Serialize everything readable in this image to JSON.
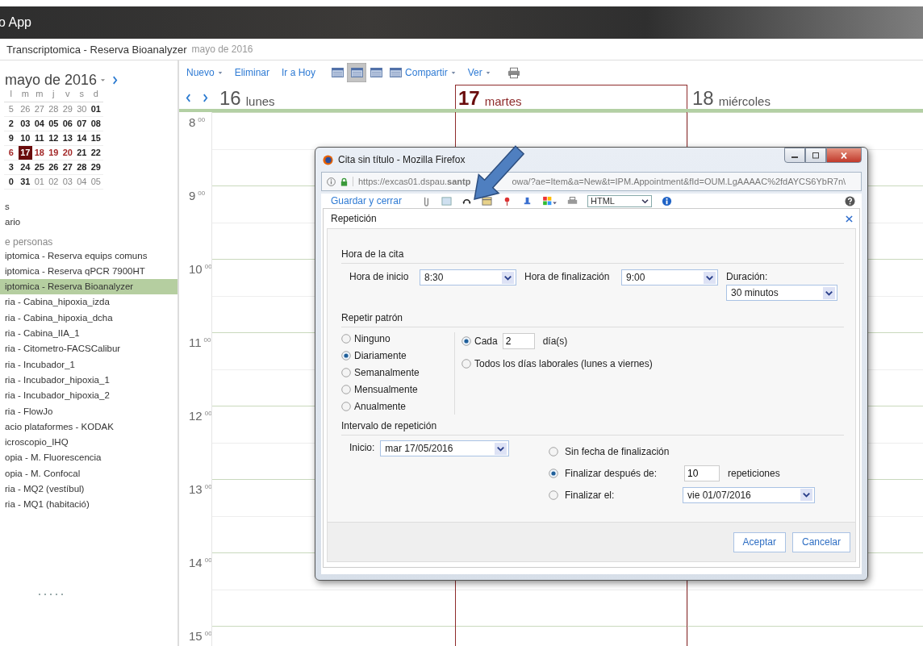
{
  "app_header": {
    "title": "o App"
  },
  "breadcrumb": {
    "calendar": "Transcriptomica - Reserva Bioanalyzer",
    "period": "mayo de 2016"
  },
  "mini_calendar": {
    "month": "mayo de 2016",
    "weekdays": [
      "l",
      "m",
      "m",
      "j",
      "v",
      "s",
      "d"
    ],
    "weeks": [
      [
        {
          "text": "5",
          "kind": "other",
          "selected": false
        },
        {
          "text": "26",
          "kind": "other",
          "selected": false
        },
        {
          "text": "27",
          "kind": "other",
          "selected": false
        },
        {
          "text": "28",
          "kind": "other",
          "selected": false
        },
        {
          "text": "29",
          "kind": "other",
          "selected": false
        },
        {
          "text": "30",
          "kind": "other",
          "selected": false
        },
        {
          "text": "01",
          "kind": "month",
          "selected": false
        }
      ],
      [
        {
          "text": "2",
          "kind": "month",
          "selected": false
        },
        {
          "text": "03",
          "kind": "month",
          "selected": false
        },
        {
          "text": "04",
          "kind": "month",
          "selected": false
        },
        {
          "text": "05",
          "kind": "month",
          "selected": false
        },
        {
          "text": "06",
          "kind": "month",
          "selected": false
        },
        {
          "text": "07",
          "kind": "month",
          "selected": false
        },
        {
          "text": "08",
          "kind": "month",
          "selected": false
        }
      ],
      [
        {
          "text": "9",
          "kind": "month",
          "selected": false
        },
        {
          "text": "10",
          "kind": "month",
          "selected": false
        },
        {
          "text": "11",
          "kind": "month",
          "selected": false
        },
        {
          "text": "12",
          "kind": "month",
          "selected": false
        },
        {
          "text": "13",
          "kind": "month",
          "selected": false
        },
        {
          "text": "14",
          "kind": "month",
          "selected": false
        },
        {
          "text": "15",
          "kind": "month",
          "selected": false
        }
      ],
      [
        {
          "text": "6",
          "kind": "week",
          "selected": false
        },
        {
          "text": "17",
          "kind": "week",
          "selected": true
        },
        {
          "text": "18",
          "kind": "week",
          "selected": false
        },
        {
          "text": "19",
          "kind": "week",
          "selected": false
        },
        {
          "text": "20",
          "kind": "week",
          "selected": false
        },
        {
          "text": "21",
          "kind": "month",
          "selected": false
        },
        {
          "text": "22",
          "kind": "month",
          "selected": false
        }
      ],
      [
        {
          "text": "3",
          "kind": "month",
          "selected": false
        },
        {
          "text": "24",
          "kind": "month",
          "selected": false
        },
        {
          "text": "25",
          "kind": "month",
          "selected": false
        },
        {
          "text": "26",
          "kind": "month",
          "selected": false
        },
        {
          "text": "27",
          "kind": "month",
          "selected": false
        },
        {
          "text": "28",
          "kind": "month",
          "selected": false
        },
        {
          "text": "29",
          "kind": "month",
          "selected": false
        }
      ],
      [
        {
          "text": "0",
          "kind": "month",
          "selected": false
        },
        {
          "text": "31",
          "kind": "month",
          "selected": false
        },
        {
          "text": "01",
          "kind": "other",
          "selected": false
        },
        {
          "text": "02",
          "kind": "other",
          "selected": false
        },
        {
          "text": "03",
          "kind": "other",
          "selected": false
        },
        {
          "text": "04",
          "kind": "other",
          "selected": false
        },
        {
          "text": "05",
          "kind": "other",
          "selected": false
        }
      ]
    ]
  },
  "sidebar": {
    "my_calendars": [
      "s",
      "ario"
    ],
    "people_heading": "e personas",
    "people": [
      {
        "label": "iptomica - Reserva equips comuns",
        "selected": false
      },
      {
        "label": "iptomica - Reserva qPCR 7900HT",
        "selected": false
      },
      {
        "label": "iptomica - Reserva Bioanalyzer",
        "selected": true
      },
      {
        "label": "ria - Cabina_hipoxia_izda",
        "selected": false
      },
      {
        "label": "ria - Cabina_hipoxia_dcha",
        "selected": false
      },
      {
        "label": "ria - Cabina_IIA_1",
        "selected": false
      },
      {
        "label": "ria - Citometro-FACSCalibur",
        "selected": false
      },
      {
        "label": "ria - Incubador_1",
        "selected": false
      },
      {
        "label": "ria - Incubador_hipoxia_1",
        "selected": false
      },
      {
        "label": "ria - Incubador_hipoxia_2",
        "selected": false
      },
      {
        "label": "ria - FlowJo",
        "selected": false
      },
      {
        "label": "acio plataformes - KODAK",
        "selected": false
      },
      {
        "label": "icroscopio_IHQ",
        "selected": false
      },
      {
        "label": "opia - M. Fluorescencia",
        "selected": false
      },
      {
        "label": "opia - M. Confocal",
        "selected": false
      },
      {
        "label": "ria - MQ2 (vestíbul)",
        "selected": false
      },
      {
        "label": "ria - MQ1 (habitació)",
        "selected": false
      }
    ]
  },
  "toolbar": [
    {
      "kind": "menu",
      "label": "Nuevo"
    },
    {
      "kind": "link",
      "label": "Eliminar"
    },
    {
      "kind": "link",
      "label": "Ir a Hoy"
    },
    {
      "kind": "view",
      "selected": false
    },
    {
      "kind": "view",
      "selected": true
    },
    {
      "kind": "view",
      "selected": false
    },
    {
      "kind": "view",
      "selected": false
    },
    {
      "kind": "menu",
      "label": "Compartir"
    },
    {
      "kind": "menu",
      "label": "Ver"
    },
    {
      "kind": "print"
    }
  ],
  "days": [
    {
      "number": "16",
      "name": "lunes",
      "today": false
    },
    {
      "number": "17",
      "name": "martes",
      "today": true
    },
    {
      "number": "18",
      "name": "miércoles",
      "today": false
    }
  ],
  "hours": [
    {
      "hour": "8",
      "minutes": "00"
    },
    {
      "hour": "9",
      "minutes": "00"
    },
    {
      "hour": "10",
      "minutes": "00"
    },
    {
      "hour": "11",
      "minutes": "00"
    },
    {
      "hour": "12",
      "minutes": "00"
    },
    {
      "hour": "13",
      "minutes": "00"
    },
    {
      "hour": "14",
      "minutes": "00"
    },
    {
      "hour": "15",
      "minutes": "00"
    }
  ],
  "dialog": {
    "window_title": "Cita sin título - Mozilla Firefox",
    "url_parts": [
      "https://excas01.dspau.**santp**",
      "owa/?ae=Item&a=New&t=IPM.Appointment&fId=OUM.LgAAAAC%2fdAYCS6YbR7n\\"
    ],
    "toolbar": {
      "save": "Guardar y cerrar",
      "format": "HTML"
    },
    "panel": {
      "title": "Repetición",
      "time": {
        "heading": "Hora de la cita",
        "start_label": "Hora de inicio",
        "start": "8:30",
        "end_label": "Hora de finalización",
        "end": "9:00",
        "duration_label": "Duración:",
        "duration": "30 minutos"
      },
      "pattern": {
        "heading": "Repetir patrón",
        "options": [
          {
            "label": "Ninguno",
            "selected": false
          },
          {
            "label": "Diariamente",
            "selected": true
          },
          {
            "label": "Semanalmente",
            "selected": false
          },
          {
            "label": "Mensualmente",
            "selected": false
          },
          {
            "label": "Anualmente",
            "selected": false
          }
        ],
        "every": {
          "label": "Cada",
          "value": "2",
          "unit": "día(s)",
          "selected": true
        },
        "weekdays": {
          "label": "Todos los días laborales (lunes a viernes)",
          "selected": false
        }
      },
      "range": {
        "heading": "Intervalo de repetición",
        "start_label": "Inicio:",
        "start": "mar 17/05/2016",
        "end_options": [
          {
            "kind": "none",
            "label": "Sin fecha de finalización",
            "selected": false
          },
          {
            "kind": "count",
            "label": "Finalizar después de:",
            "value": "10",
            "unit": "repeticiones",
            "selected": true
          },
          {
            "kind": "date",
            "label": "Finalizar el:",
            "value": "vie 01/07/2016",
            "selected": false
          }
        ]
      },
      "buttons": [
        "Aceptar",
        "Cancelar"
      ]
    }
  }
}
